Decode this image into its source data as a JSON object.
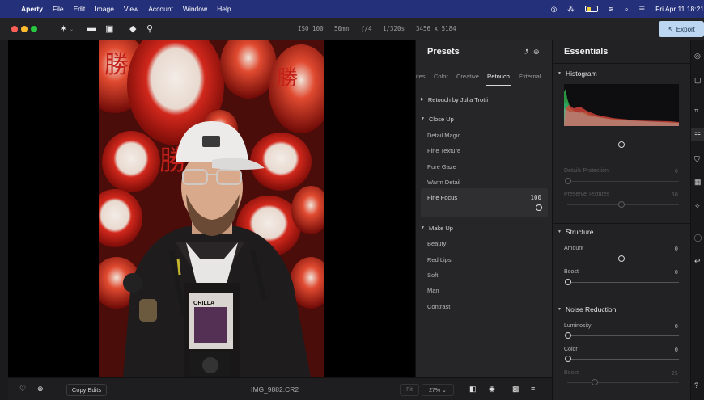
{
  "menubar": {
    "app_name": "Aperty",
    "menus": [
      "File",
      "Edit",
      "Image",
      "View",
      "Account",
      "Window",
      "Help"
    ],
    "clock": "Fri Apr 11  18:21"
  },
  "toolbar": {
    "exif": [
      "ISO 100",
      "50mm",
      "ƒ/4",
      "1/320s",
      "3456 x 5184"
    ],
    "export_label": "Export"
  },
  "bottombar": {
    "copy_edits_label": "Copy Edits",
    "filename": "IMG_9882.CR2",
    "fit_label": "Fit",
    "zoom_label": "27% ⌄"
  },
  "presets": {
    "title": "Presets",
    "tabs": [
      "ites",
      "Color",
      "Creative",
      "Retouch",
      "External"
    ],
    "active_tab": "Retouch",
    "group_julia": "Retouch by Julia Trotti",
    "group_closeup": "Close Up",
    "closeup_items": [
      "Detail Magic",
      "Fine Texture",
      "Pure Gaze",
      "Warm Detail"
    ],
    "selected": {
      "name": "Fine Focus",
      "value": "100",
      "amount": 1.0
    },
    "group_makeup": "Make Up",
    "makeup_items": [
      "Beauty",
      "Red Lips",
      "Soft",
      "Man",
      "Contrast"
    ]
  },
  "essentials": {
    "title": "Essentials",
    "histogram_label": "Histogram",
    "details_protection": {
      "label": "Details Protection",
      "value": "0"
    },
    "preserve_textures": {
      "label": "Preserve Textures",
      "value": "50"
    },
    "structure": {
      "label": "Structure",
      "amount": {
        "label": "Amount",
        "value": "0"
      },
      "boost": {
        "label": "Boost",
        "value": "0"
      }
    },
    "noise_reduction": {
      "label": "Noise Reduction",
      "luminosity": {
        "label": "Luminosity",
        "value": "0"
      },
      "color": {
        "label": "Color",
        "value": "0"
      },
      "boost": {
        "label": "Boost",
        "value": "25"
      }
    }
  },
  "colors": {
    "menubar_bg": "#24307a",
    "export_bg": "#bcd6f2",
    "traffic_red": "#ff5f57",
    "traffic_yellow": "#febc2e",
    "traffic_green": "#28c840"
  }
}
